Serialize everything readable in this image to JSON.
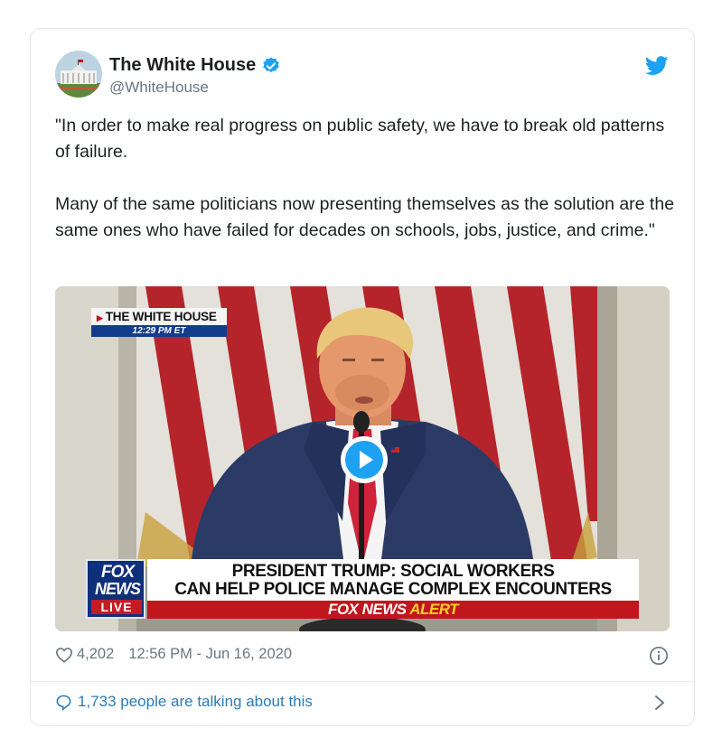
{
  "tweet": {
    "author_name": "The White House",
    "author_handle": "@WhiteHouse",
    "paragraphs": [
      "\"In order to make real progress on public safety, we have to break old patterns of failure.",
      "Many of the same politicians now presenting themselves as the solution are the same ones who have failed for decades on schools, jobs, justice, and crime.\""
    ],
    "likes": "4,202",
    "timestamp": "12:56 PM - Jun 16, 2020",
    "talking": "1,733 people are talking about this"
  },
  "video": {
    "bug_title": "THE WHITE HOUSE",
    "bug_time": "12:29 PM ET",
    "headline_line1": "PRESIDENT TRUMP: SOCIAL WORKERS",
    "headline_line2": "CAN HELP POLICE MANAGE COMPLEX ENCOUNTERS",
    "alert_brand": "FOX NEWS",
    "alert_word": "ALERT",
    "logo_line1": "FOX",
    "logo_line2": "NEWS",
    "logo_live": "LIVE"
  },
  "icons": {
    "verified": "verified-badge-icon",
    "bird": "twitter-bird-icon",
    "heart": "heart-icon",
    "info": "info-icon",
    "bubble": "speech-bubble-icon",
    "chevron": "chevron-right-icon",
    "play": "play-icon"
  },
  "colors": {
    "accent": "#1da1f2",
    "link": "#2b7bb9",
    "muted": "#697882",
    "fox_blue": "#0e2f7a",
    "fox_red": "#c2161e"
  }
}
